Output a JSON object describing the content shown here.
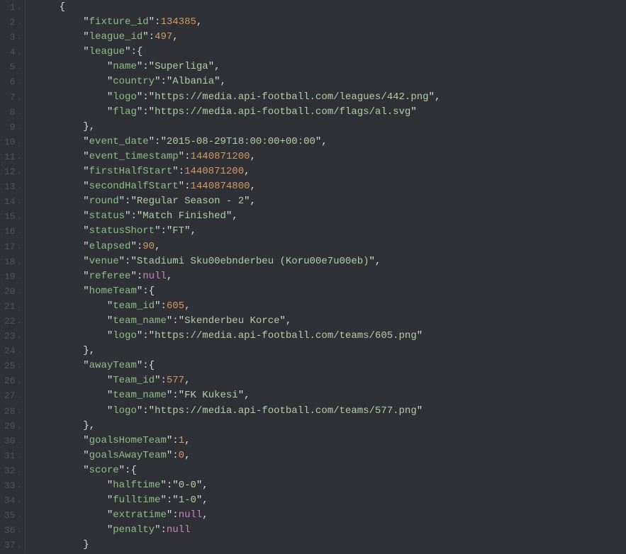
{
  "lines": [
    {
      "num": "1",
      "tokens": [
        {
          "cls": "p",
          "t": "{"
        }
      ],
      "indent": 1
    },
    {
      "num": "2",
      "tokens": [
        {
          "cls": "p",
          "t": "\""
        },
        {
          "cls": "k",
          "t": "fixture_id"
        },
        {
          "cls": "p",
          "t": "\":"
        },
        {
          "cls": "n",
          "t": "134385"
        },
        {
          "cls": "p",
          "t": ","
        }
      ],
      "indent": 2
    },
    {
      "num": "3",
      "tokens": [
        {
          "cls": "p",
          "t": "\""
        },
        {
          "cls": "k",
          "t": "league_id"
        },
        {
          "cls": "p",
          "t": "\":"
        },
        {
          "cls": "n",
          "t": "497"
        },
        {
          "cls": "p",
          "t": ","
        }
      ],
      "indent": 2
    },
    {
      "num": "4",
      "tokens": [
        {
          "cls": "p",
          "t": "\""
        },
        {
          "cls": "k",
          "t": "league"
        },
        {
          "cls": "p",
          "t": "\":{"
        }
      ],
      "indent": 2
    },
    {
      "num": "5",
      "tokens": [
        {
          "cls": "p",
          "t": "\""
        },
        {
          "cls": "k",
          "t": "name"
        },
        {
          "cls": "p",
          "t": "\":\""
        },
        {
          "cls": "s",
          "t": "Superliga"
        },
        {
          "cls": "p",
          "t": "\","
        }
      ],
      "indent": 3
    },
    {
      "num": "6",
      "tokens": [
        {
          "cls": "p",
          "t": "\""
        },
        {
          "cls": "k",
          "t": "country"
        },
        {
          "cls": "p",
          "t": "\":\""
        },
        {
          "cls": "s",
          "t": "Albania"
        },
        {
          "cls": "p",
          "t": "\","
        }
      ],
      "indent": 3
    },
    {
      "num": "7",
      "tokens": [
        {
          "cls": "p",
          "t": "\""
        },
        {
          "cls": "k",
          "t": "logo"
        },
        {
          "cls": "p",
          "t": "\":\""
        },
        {
          "cls": "s",
          "t": "https://media.api-football.com/leagues/442.png"
        },
        {
          "cls": "p",
          "t": "\","
        }
      ],
      "indent": 3
    },
    {
      "num": "8",
      "tokens": [
        {
          "cls": "p",
          "t": "\""
        },
        {
          "cls": "k",
          "t": "flag"
        },
        {
          "cls": "p",
          "t": "\":\""
        },
        {
          "cls": "s",
          "t": "https://media.api-football.com/flags/al.svg"
        },
        {
          "cls": "p",
          "t": "\""
        }
      ],
      "indent": 3
    },
    {
      "num": "9",
      "tokens": [
        {
          "cls": "p",
          "t": "},"
        }
      ],
      "indent": 2
    },
    {
      "num": "10",
      "tokens": [
        {
          "cls": "p",
          "t": "\""
        },
        {
          "cls": "k",
          "t": "event_date"
        },
        {
          "cls": "p",
          "t": "\":\""
        },
        {
          "cls": "s",
          "t": "2015-08-29T18:00:00+00:00"
        },
        {
          "cls": "p",
          "t": "\","
        }
      ],
      "indent": 2
    },
    {
      "num": "11",
      "tokens": [
        {
          "cls": "p",
          "t": "\""
        },
        {
          "cls": "k",
          "t": "event_timestamp"
        },
        {
          "cls": "p",
          "t": "\":"
        },
        {
          "cls": "n",
          "t": "1440871200"
        },
        {
          "cls": "p",
          "t": ","
        }
      ],
      "indent": 2
    },
    {
      "num": "12",
      "tokens": [
        {
          "cls": "p",
          "t": "\""
        },
        {
          "cls": "k",
          "t": "firstHalfStart"
        },
        {
          "cls": "p",
          "t": "\":"
        },
        {
          "cls": "n",
          "t": "1440871200"
        },
        {
          "cls": "p",
          "t": ","
        }
      ],
      "indent": 2
    },
    {
      "num": "13",
      "tokens": [
        {
          "cls": "p",
          "t": "\""
        },
        {
          "cls": "k",
          "t": "secondHalfStart"
        },
        {
          "cls": "p",
          "t": "\":"
        },
        {
          "cls": "n",
          "t": "1440874800"
        },
        {
          "cls": "p",
          "t": ","
        }
      ],
      "indent": 2
    },
    {
      "num": "14",
      "tokens": [
        {
          "cls": "p",
          "t": "\""
        },
        {
          "cls": "k",
          "t": "round"
        },
        {
          "cls": "p",
          "t": "\":\""
        },
        {
          "cls": "s",
          "t": "Regular Season - 2"
        },
        {
          "cls": "p",
          "t": "\","
        }
      ],
      "indent": 2
    },
    {
      "num": "15",
      "tokens": [
        {
          "cls": "p",
          "t": "\""
        },
        {
          "cls": "k",
          "t": "status"
        },
        {
          "cls": "p",
          "t": "\":\""
        },
        {
          "cls": "s",
          "t": "Match Finished"
        },
        {
          "cls": "p",
          "t": "\","
        }
      ],
      "indent": 2
    },
    {
      "num": "16",
      "tokens": [
        {
          "cls": "p",
          "t": "\""
        },
        {
          "cls": "k",
          "t": "statusShort"
        },
        {
          "cls": "p",
          "t": "\":\""
        },
        {
          "cls": "s",
          "t": "FT"
        },
        {
          "cls": "p",
          "t": "\","
        }
      ],
      "indent": 2
    },
    {
      "num": "17",
      "tokens": [
        {
          "cls": "p",
          "t": "\""
        },
        {
          "cls": "k",
          "t": "elapsed"
        },
        {
          "cls": "p",
          "t": "\":"
        },
        {
          "cls": "n",
          "t": "90"
        },
        {
          "cls": "p",
          "t": ","
        }
      ],
      "indent": 2
    },
    {
      "num": "18",
      "tokens": [
        {
          "cls": "p",
          "t": "\""
        },
        {
          "cls": "k",
          "t": "venue"
        },
        {
          "cls": "p",
          "t": "\":\""
        },
        {
          "cls": "s",
          "t": "Stadiumi Sku00ebnderbeu (Koru00e7u00eb)"
        },
        {
          "cls": "p",
          "t": "\","
        }
      ],
      "indent": 2
    },
    {
      "num": "19",
      "tokens": [
        {
          "cls": "p",
          "t": "\""
        },
        {
          "cls": "k",
          "t": "referee"
        },
        {
          "cls": "p",
          "t": "\":"
        },
        {
          "cls": "nl",
          "t": "null"
        },
        {
          "cls": "p",
          "t": ","
        }
      ],
      "indent": 2
    },
    {
      "num": "20",
      "tokens": [
        {
          "cls": "p",
          "t": "\""
        },
        {
          "cls": "k",
          "t": "homeTeam"
        },
        {
          "cls": "p",
          "t": "\":{"
        }
      ],
      "indent": 2
    },
    {
      "num": "21",
      "tokens": [
        {
          "cls": "p",
          "t": "\""
        },
        {
          "cls": "k",
          "t": "team_id"
        },
        {
          "cls": "p",
          "t": "\":"
        },
        {
          "cls": "n",
          "t": "605"
        },
        {
          "cls": "p",
          "t": ","
        }
      ],
      "indent": 3
    },
    {
      "num": "22",
      "tokens": [
        {
          "cls": "p",
          "t": "\""
        },
        {
          "cls": "k",
          "t": "team_name"
        },
        {
          "cls": "p",
          "t": "\":\""
        },
        {
          "cls": "s",
          "t": "Skenderbeu Korce"
        },
        {
          "cls": "p",
          "t": "\","
        }
      ],
      "indent": 3
    },
    {
      "num": "23",
      "tokens": [
        {
          "cls": "p",
          "t": "\""
        },
        {
          "cls": "k",
          "t": "logo"
        },
        {
          "cls": "p",
          "t": "\":\""
        },
        {
          "cls": "s",
          "t": "https://media.api-football.com/teams/605.png"
        },
        {
          "cls": "p",
          "t": "\""
        }
      ],
      "indent": 3
    },
    {
      "num": "24",
      "tokens": [
        {
          "cls": "p",
          "t": "},"
        }
      ],
      "indent": 2
    },
    {
      "num": "25",
      "tokens": [
        {
          "cls": "p",
          "t": "\""
        },
        {
          "cls": "k",
          "t": "awayTeam"
        },
        {
          "cls": "p",
          "t": "\":{"
        }
      ],
      "indent": 2
    },
    {
      "num": "26",
      "tokens": [
        {
          "cls": "p",
          "t": "\""
        },
        {
          "cls": "k",
          "t": "Team_id"
        },
        {
          "cls": "p",
          "t": "\":"
        },
        {
          "cls": "n",
          "t": "577"
        },
        {
          "cls": "p",
          "t": ","
        }
      ],
      "indent": 3
    },
    {
      "num": "27",
      "tokens": [
        {
          "cls": "p",
          "t": "\""
        },
        {
          "cls": "k",
          "t": "team_name"
        },
        {
          "cls": "p",
          "t": "\":\""
        },
        {
          "cls": "s",
          "t": "FK Kukesi"
        },
        {
          "cls": "p",
          "t": "\","
        }
      ],
      "indent": 3
    },
    {
      "num": "28",
      "tokens": [
        {
          "cls": "p",
          "t": "\""
        },
        {
          "cls": "k",
          "t": "logo"
        },
        {
          "cls": "p",
          "t": "\":\""
        },
        {
          "cls": "s",
          "t": "https://media.api-football.com/teams/577.png"
        },
        {
          "cls": "p",
          "t": "\""
        }
      ],
      "indent": 3
    },
    {
      "num": "29",
      "tokens": [
        {
          "cls": "p",
          "t": "},"
        }
      ],
      "indent": 2
    },
    {
      "num": "30",
      "tokens": [
        {
          "cls": "p",
          "t": "\""
        },
        {
          "cls": "k",
          "t": "goalsHomeTeam"
        },
        {
          "cls": "p",
          "t": "\":"
        },
        {
          "cls": "n",
          "t": "1"
        },
        {
          "cls": "p",
          "t": ","
        }
      ],
      "indent": 2
    },
    {
      "num": "31",
      "tokens": [
        {
          "cls": "p",
          "t": "\""
        },
        {
          "cls": "k",
          "t": "goalsAwayTeam"
        },
        {
          "cls": "p",
          "t": "\":"
        },
        {
          "cls": "n",
          "t": "0"
        },
        {
          "cls": "p",
          "t": ","
        }
      ],
      "indent": 2
    },
    {
      "num": "32",
      "tokens": [
        {
          "cls": "p",
          "t": "\""
        },
        {
          "cls": "k",
          "t": "score"
        },
        {
          "cls": "p",
          "t": "\":{"
        }
      ],
      "indent": 2
    },
    {
      "num": "33",
      "tokens": [
        {
          "cls": "p",
          "t": "\""
        },
        {
          "cls": "k",
          "t": "halftime"
        },
        {
          "cls": "p",
          "t": "\":\""
        },
        {
          "cls": "s",
          "t": "0-0"
        },
        {
          "cls": "p",
          "t": "\","
        }
      ],
      "indent": 3
    },
    {
      "num": "34",
      "tokens": [
        {
          "cls": "p",
          "t": "\""
        },
        {
          "cls": "k",
          "t": "fulltime"
        },
        {
          "cls": "p",
          "t": "\":\""
        },
        {
          "cls": "s",
          "t": "1-0"
        },
        {
          "cls": "p",
          "t": "\","
        }
      ],
      "indent": 3
    },
    {
      "num": "35",
      "tokens": [
        {
          "cls": "p",
          "t": "\""
        },
        {
          "cls": "k",
          "t": "extratime"
        },
        {
          "cls": "p",
          "t": "\":"
        },
        {
          "cls": "nl",
          "t": "null"
        },
        {
          "cls": "p",
          "t": ","
        }
      ],
      "indent": 3
    },
    {
      "num": "36",
      "tokens": [
        {
          "cls": "p",
          "t": "\""
        },
        {
          "cls": "k",
          "t": "penalty"
        },
        {
          "cls": "p",
          "t": "\":"
        },
        {
          "cls": "nl",
          "t": "null"
        }
      ],
      "indent": 3
    },
    {
      "num": "37",
      "tokens": [
        {
          "cls": "p",
          "t": "}"
        }
      ],
      "indent": 2
    }
  ],
  "indentUnit": "    "
}
